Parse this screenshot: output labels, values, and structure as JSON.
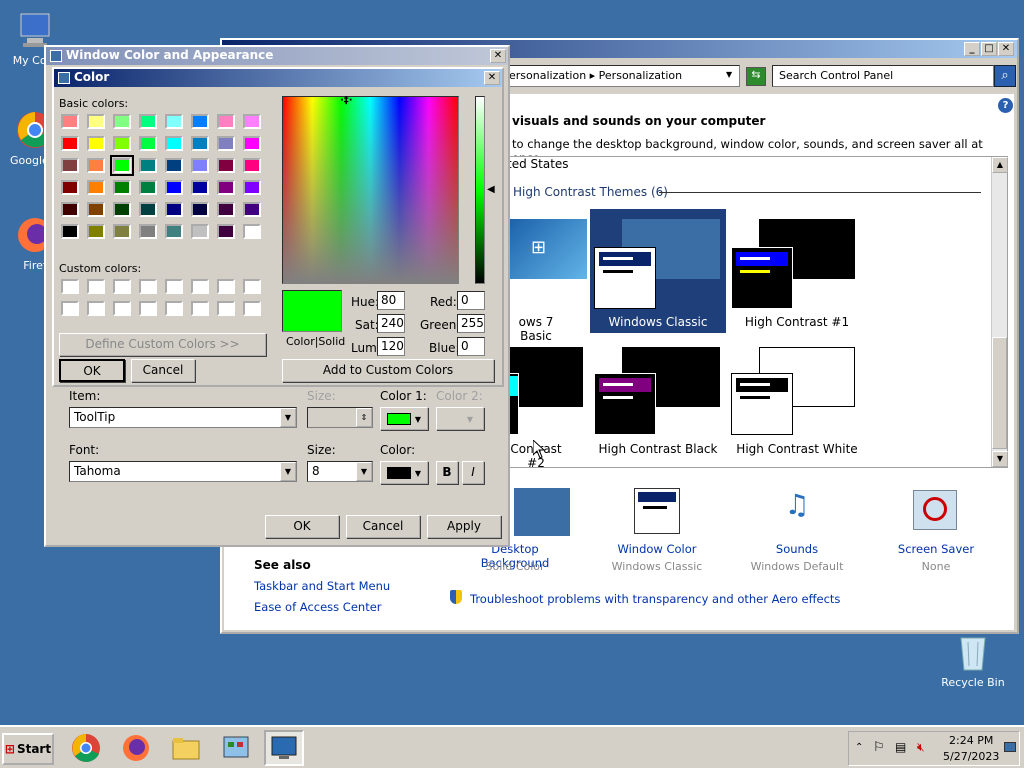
{
  "desktop": {
    "icons": [
      {
        "label": "My Com"
      },
      {
        "label": "Google C"
      },
      {
        "label": "Firef"
      },
      {
        "label": "Recycle Bin"
      }
    ]
  },
  "control_panel": {
    "breadcrumb": "ersonalization ▸ Personalization",
    "search_placeholder": "Search Control Panel",
    "heading": "visuals and sounds on your computer",
    "subheading": "to change the desktop background, window color, sounds, and screen saver all at once.",
    "group_prev": "ted States",
    "group_title": "High Contrast Themes (6)",
    "themes": [
      {
        "label": "ows 7 Basic"
      },
      {
        "label": "Windows Classic"
      },
      {
        "label": "High Contrast #1"
      },
      {
        "label": "Contrast #2"
      },
      {
        "label": "High Contrast Black"
      },
      {
        "label": "High Contrast White"
      }
    ],
    "bottom": [
      {
        "title": "Desktop Background",
        "value": "Solid Color"
      },
      {
        "title": "Window Color",
        "value": "Windows Classic"
      },
      {
        "title": "Sounds",
        "value": "Windows Default"
      },
      {
        "title": "Screen Saver",
        "value": "None"
      }
    ],
    "see_also": "See also",
    "links": [
      "Taskbar and Start Menu",
      "Ease of Access Center"
    ],
    "troubleshoot": "Troubleshoot problems with transparency and other Aero effects"
  },
  "wca": {
    "title": "Window Color and Appearance",
    "item_label": "Item:",
    "item_value": "ToolTip",
    "size_label": "Size:",
    "color1_label": "Color 1:",
    "color2_label": "Color 2:",
    "font_label": "Font:",
    "font_value": "Tahoma",
    "font_size_label": "Size:",
    "font_size_value": "8",
    "font_color_label": "Color:",
    "bold": "B",
    "italic": "I",
    "ok": "OK",
    "cancel": "Cancel",
    "apply": "Apply"
  },
  "color_dialog": {
    "title": "Color",
    "basic_label": "Basic colors:",
    "custom_label": "Custom colors:",
    "define_btn": "Define Custom Colors >>",
    "ok": "OK",
    "cancel": "Cancel",
    "solid_label": "Color|Solid",
    "hue_label": "Hue:",
    "hue": "80",
    "sat_label": "Sat:",
    "sat": "240",
    "lum_label": "Lum:",
    "lum": "120",
    "red_label": "Red:",
    "red": "0",
    "green_label": "Green:",
    "green": "255",
    "blue_label": "Blue:",
    "blue": "0",
    "add_btn": "Add to Custom Colors",
    "basic_colors": [
      "#ff8080",
      "#ffff80",
      "#80ff80",
      "#00ff80",
      "#80ffff",
      "#0080ff",
      "#ff80c0",
      "#ff80ff",
      "#ff0000",
      "#ffff00",
      "#80ff00",
      "#00ff40",
      "#00ffff",
      "#0080c0",
      "#8080c0",
      "#ff00ff",
      "#804040",
      "#ff8040",
      "#00ff00",
      "#008080",
      "#004080",
      "#8080ff",
      "#800040",
      "#ff0080",
      "#800000",
      "#ff8000",
      "#008000",
      "#008040",
      "#0000ff",
      "#0000a0",
      "#800080",
      "#8000ff",
      "#400000",
      "#804000",
      "#004000",
      "#004040",
      "#000080",
      "#000040",
      "#400040",
      "#400080",
      "#000000",
      "#808000",
      "#808040",
      "#808080",
      "#408080",
      "#c0c0c0",
      "#400040",
      "#ffffff"
    ],
    "selected_index": 18,
    "solid_color": "#00ff00"
  },
  "taskbar": {
    "start": "Start",
    "time": "2:24 PM",
    "date": "5/27/2023"
  }
}
